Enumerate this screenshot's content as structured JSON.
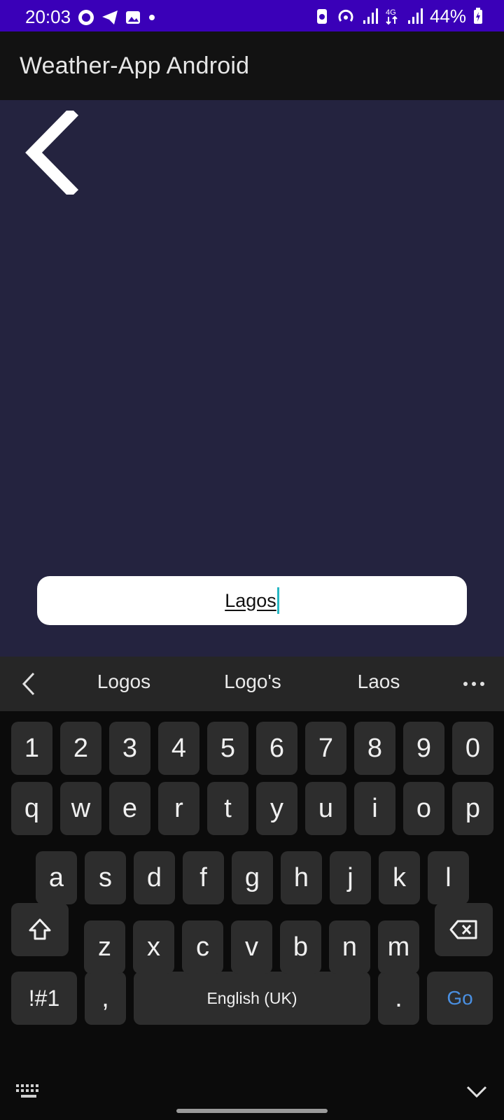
{
  "status_bar": {
    "time": "20:03",
    "battery": "44%",
    "network": "4G",
    "left_icons": [
      "whatsapp-icon",
      "telegram-icon",
      "gallery-icon",
      "dot-icon"
    ],
    "right_icons": [
      "battery-saver-icon",
      "hotspot-icon",
      "signal-icon",
      "signal-4g-icon",
      "signal-icon",
      "battery-icon"
    ]
  },
  "app_bar": {
    "title": "Weather-App Android"
  },
  "main": {
    "back_icon": "chevron-left-icon",
    "search": {
      "value": "Lagos"
    }
  },
  "keyboard": {
    "suggestions": [
      "Logos",
      "Logo's",
      "Laos"
    ],
    "row_numbers": [
      "1",
      "2",
      "3",
      "4",
      "5",
      "6",
      "7",
      "8",
      "9",
      "0"
    ],
    "row_top": [
      "q",
      "w",
      "e",
      "r",
      "t",
      "y",
      "u",
      "i",
      "o",
      "p"
    ],
    "row_mid": [
      "a",
      "s",
      "d",
      "f",
      "g",
      "h",
      "j",
      "k",
      "l"
    ],
    "row_bottom": [
      "z",
      "x",
      "c",
      "v",
      "b",
      "n",
      "m"
    ],
    "sym_label": "!#1",
    "comma_label": ",",
    "space_label": "English (UK)",
    "period_label": ".",
    "go_label": "Go"
  },
  "colors": {
    "status_bar": "#3a00b8",
    "app_bar": "#121212",
    "content_bg": "#24233f",
    "key_bg": "#2d2d2d",
    "go_accent": "#4a90e2",
    "caret": "#26b7c3"
  }
}
